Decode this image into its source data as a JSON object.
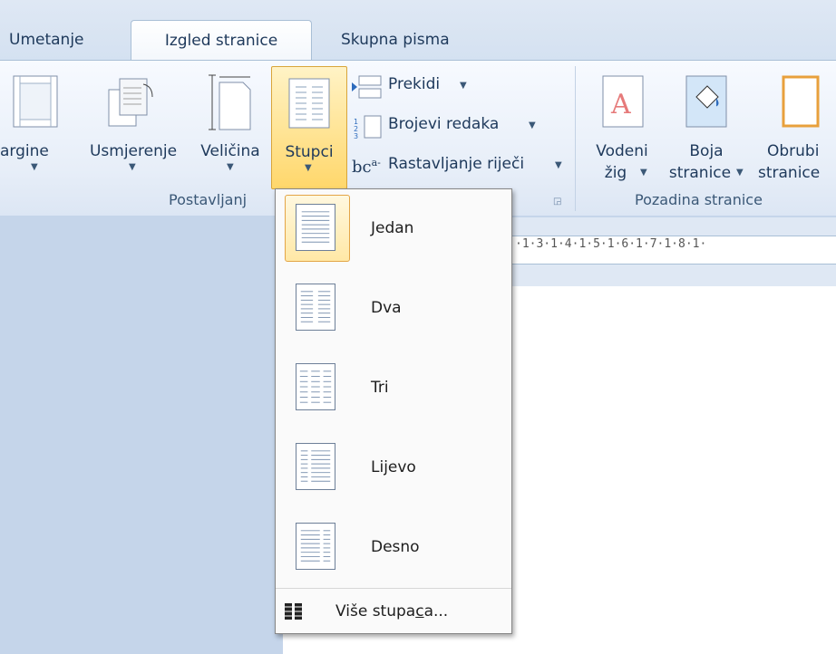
{
  "tabs": [
    {
      "label": "Umetanje",
      "active": false
    },
    {
      "label": "Izgled stranice",
      "active": true
    },
    {
      "label": "Skupna pisma",
      "active": false
    }
  ],
  "ribbon": {
    "page_setup": {
      "group_label": "Postavljanj",
      "margins": "argine",
      "orientation": "Usmjerenje",
      "size": "Veličina",
      "columns": "Stupci",
      "breaks": "Prekidi",
      "line_numbers": "Brojevi redaka",
      "hyphenation": "Rastavljanje riječi",
      "hyphenation_icon_text": "bc",
      "hyphenation_icon_sup": "a-"
    },
    "page_background": {
      "group_label": "Pozadina stranice",
      "watermark_line1": "Vodeni",
      "watermark_line2": "žig",
      "page_color_line1": "Boja",
      "page_color_line2": "stranice",
      "page_borders_line1": "Obrubi",
      "page_borders_line2": "stranice"
    }
  },
  "ruler": {
    "text": "·1·3·1·4·1·5·1·6·1·7·1·8·1·"
  },
  "columns_menu": {
    "items": [
      {
        "label": "Jedan",
        "selected": true
      },
      {
        "label": "Dva",
        "selected": false
      },
      {
        "label": "Tri",
        "selected": false
      },
      {
        "label": "Lijevo",
        "selected": false
      },
      {
        "label": "Desno",
        "selected": false
      }
    ],
    "more_prefix": "Više stupa",
    "more_underlined": "c",
    "more_suffix": "a..."
  },
  "colors": {
    "accent_highlight": "#ffd76b",
    "ribbon_bg": "#e7eef8",
    "text": "#1e395b"
  }
}
